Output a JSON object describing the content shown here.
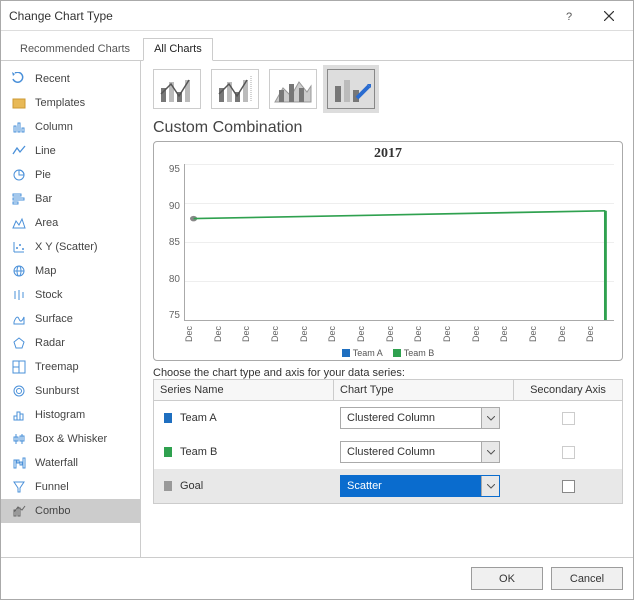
{
  "window": {
    "title": "Change Chart Type"
  },
  "tabs": {
    "recommended": "Recommended Charts",
    "all": "All Charts"
  },
  "sidebar": {
    "items": [
      {
        "label": "Recent"
      },
      {
        "label": "Templates"
      },
      {
        "label": "Column"
      },
      {
        "label": "Line"
      },
      {
        "label": "Pie"
      },
      {
        "label": "Bar"
      },
      {
        "label": "Area"
      },
      {
        "label": "X Y (Scatter)"
      },
      {
        "label": "Map"
      },
      {
        "label": "Stock"
      },
      {
        "label": "Surface"
      },
      {
        "label": "Radar"
      },
      {
        "label": "Treemap"
      },
      {
        "label": "Sunburst"
      },
      {
        "label": "Histogram"
      },
      {
        "label": "Box & Whisker"
      },
      {
        "label": "Waterfall"
      },
      {
        "label": "Funnel"
      },
      {
        "label": "Combo"
      }
    ]
  },
  "main": {
    "section_title": "Custom Combination",
    "preview_title": "2017",
    "legend": {
      "a": "Team A",
      "b": "Team B"
    },
    "instruct": "Choose the chart type and axis for your data series:",
    "headers": {
      "name": "Series Name",
      "type": "Chart Type",
      "axis": "Secondary Axis"
    },
    "rows": [
      {
        "name": "Team A",
        "type": "Clustered Column",
        "color": "#1f6fc0"
      },
      {
        "name": "Team B",
        "type": "Clustered Column",
        "color": "#2fa14f"
      },
      {
        "name": "Goal",
        "type": "Scatter",
        "color": "#999999"
      }
    ]
  },
  "buttons": {
    "ok": "OK",
    "cancel": "Cancel"
  },
  "chart_data": {
    "type": "line",
    "title": "2017",
    "ylim": [
      75,
      95
    ],
    "yticks": [
      75,
      80,
      85,
      90,
      95
    ],
    "xticks": [
      "Dec",
      "Dec",
      "Dec",
      "Dec",
      "Dec",
      "Dec",
      "Dec",
      "Dec",
      "Dec",
      "Dec",
      "Dec",
      "Dec",
      "Dec",
      "Dec",
      "Dec"
    ],
    "series": [
      {
        "name": "Team A",
        "color": "#1f6fc0",
        "values": [
          88
        ]
      },
      {
        "name": "Team B",
        "color": "#2fa14f",
        "values": [
          89
        ]
      }
    ]
  }
}
